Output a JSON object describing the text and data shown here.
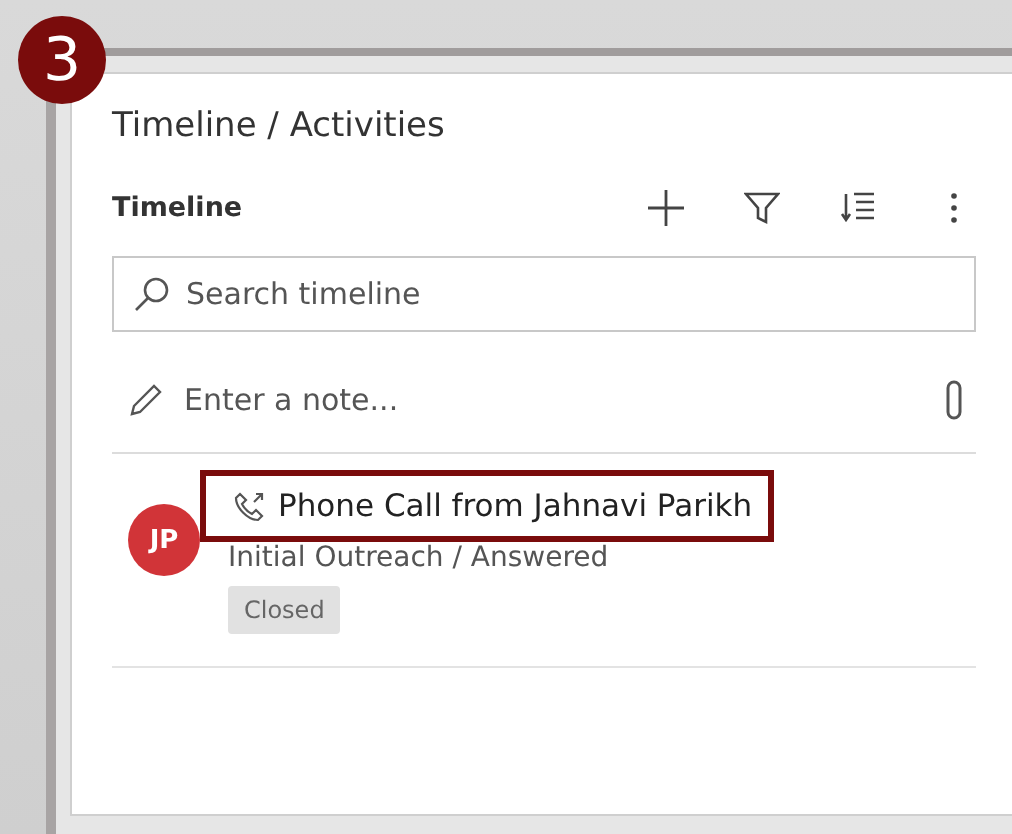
{
  "step_badge": "3",
  "panel": {
    "title": "Timeline / Activities",
    "section_label": "Timeline"
  },
  "search": {
    "placeholder": "Search timeline"
  },
  "note": {
    "placeholder": "Enter a note..."
  },
  "activities": [
    {
      "initials": "JP",
      "color": "#d13438",
      "title": "Phone Call from Jahnavi Parikh",
      "subtitle": "Initial Outreach / Answered",
      "status": "Closed",
      "highlighted": true
    }
  ]
}
